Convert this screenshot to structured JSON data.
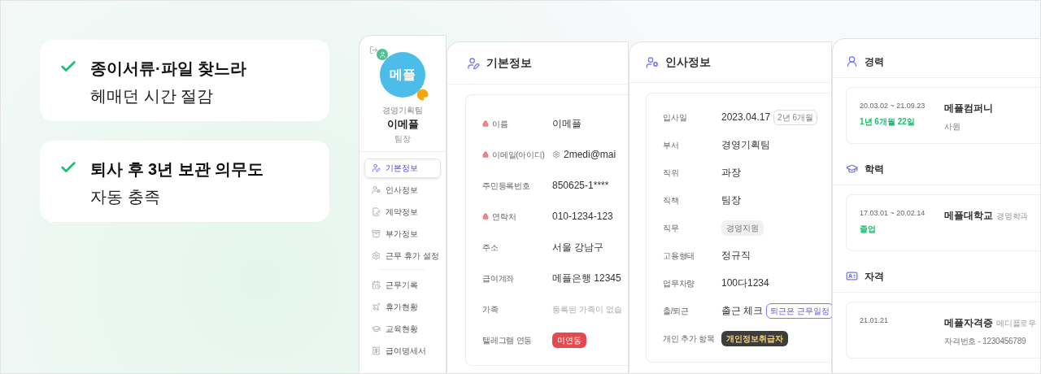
{
  "callouts": [
    {
      "title": "종이서류·파일 찾느라",
      "subtitle": "헤매던 시간 절감"
    },
    {
      "title": "퇴사 후 3년 보관 의무도",
      "subtitle": "자동 충족"
    }
  ],
  "profile": {
    "avatar_text": "메플",
    "team": "경영기획팀",
    "name": "이메플",
    "position": "팀장"
  },
  "sidebar": {
    "groups": [
      [
        {
          "label": "기본정보",
          "selected": true,
          "kind": "user-pen"
        },
        {
          "label": "인사정보",
          "selected": false,
          "kind": "user-cog"
        },
        {
          "label": "계약정보",
          "selected": false,
          "kind": "contract"
        },
        {
          "label": "부가정보",
          "selected": false,
          "kind": "archive"
        },
        {
          "label": "근무 휴가 설정",
          "selected": false,
          "kind": "settings"
        }
      ],
      [
        {
          "label": "근무기록",
          "selected": false,
          "kind": "clock"
        },
        {
          "label": "휴가현황",
          "selected": false,
          "kind": "plane"
        },
        {
          "label": "교육현황",
          "selected": false,
          "kind": "cap"
        },
        {
          "label": "급여명세서",
          "selected": false,
          "kind": "receipt"
        }
      ]
    ]
  },
  "basic_info": {
    "title": "기본정보",
    "rows": [
      {
        "label": "이름",
        "locked": true,
        "kind": "text",
        "value": "이메플"
      },
      {
        "label": "이메일(아이디)",
        "locked": true,
        "kind": "email",
        "value": "2medi@mai"
      },
      {
        "label": "주민등록번호",
        "locked": false,
        "kind": "text",
        "value": "850625-1****"
      },
      {
        "label": "연락처",
        "locked": true,
        "kind": "text",
        "value": "010-1234-123"
      },
      {
        "label": "주소",
        "locked": false,
        "kind": "text",
        "value": "서울 강남구"
      },
      {
        "label": "급여계좌",
        "locked": false,
        "kind": "text",
        "value": "메플은행 12345"
      },
      {
        "label": "가족",
        "locked": false,
        "kind": "muted",
        "value": "등록된 가족이 없습"
      },
      {
        "label": "텔레그램 연동",
        "locked": false,
        "kind": "red_tag",
        "value": "미연동"
      }
    ]
  },
  "hr_info": {
    "title": "인사정보",
    "rows": [
      {
        "label": "입사일",
        "kind": "text",
        "value": "2023.04.17",
        "chip": {
          "text": "2년 6개월",
          "kind": "plain"
        }
      },
      {
        "label": "부서",
        "kind": "text",
        "value": "경영기획팀"
      },
      {
        "label": "직위",
        "kind": "text",
        "value": "과장"
      },
      {
        "label": "직책",
        "kind": "text",
        "value": "팀장"
      },
      {
        "label": "직무",
        "kind": "tag",
        "value": "경영지원"
      },
      {
        "label": "고용형태",
        "kind": "text",
        "value": "정규직"
      },
      {
        "label": "업무차량",
        "kind": "text",
        "value": "100다1234"
      },
      {
        "label": "출/퇴근",
        "kind": "text",
        "value": "출근 체크",
        "chip": {
          "text": "퇴근은 근무일정",
          "kind": "link"
        }
      },
      {
        "label": "개인 추가 항목",
        "kind": "dark_tag",
        "value": "개인정보취급자"
      }
    ]
  },
  "history": [
    {
      "title": "경력",
      "kind": "career",
      "period": "20.03.02 ~ 21.09.23",
      "note": "1년 6개월 22일",
      "name": "메플컴퍼니",
      "detail": "사원"
    },
    {
      "title": "학력",
      "kind": "education",
      "period": "17.03.01 ~ 20.02.14",
      "note": "졸업",
      "name": "메플대학교",
      "sub": "경영학과"
    },
    {
      "title": "자격",
      "kind": "license",
      "period": "21.01.21",
      "name": "메플자격증",
      "sub": "메디플로우",
      "detail": "자격번호 - 1230456789"
    }
  ]
}
